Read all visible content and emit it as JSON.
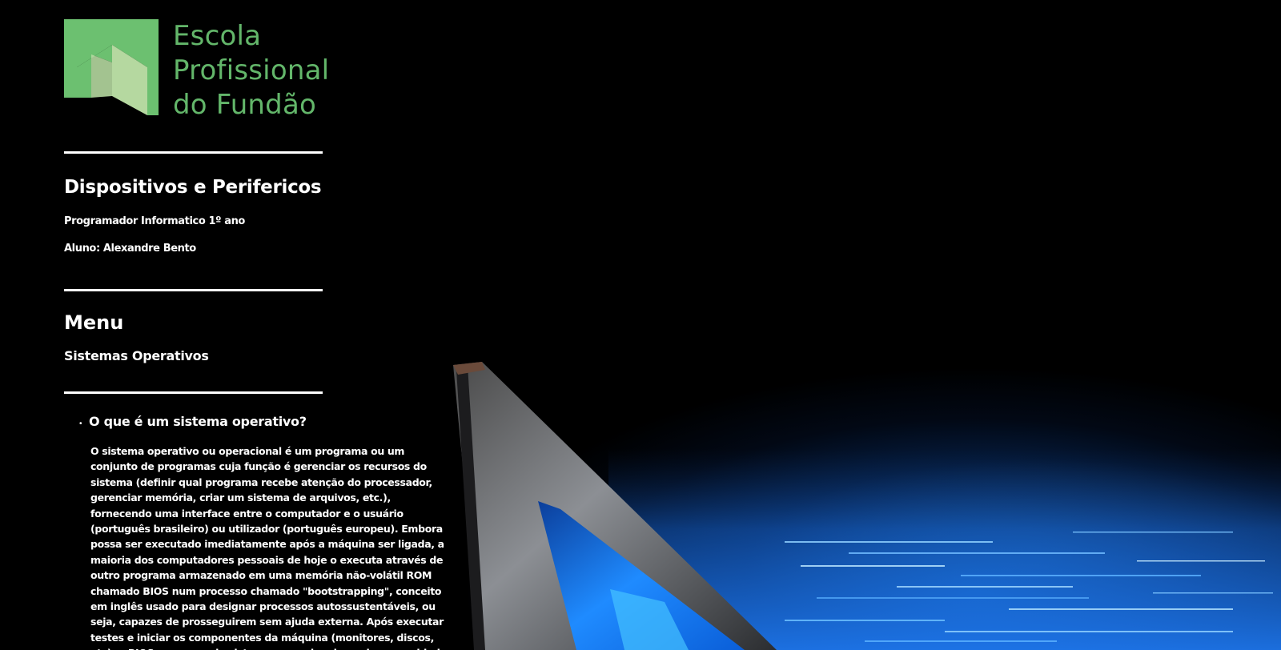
{
  "logo": {
    "line1": "Escola",
    "line2": "Profissional",
    "line3": "do Fundão",
    "color": "#63b66a",
    "mark_dark": "#6cc070",
    "mark_light": "#b5d8a0"
  },
  "header": {
    "title": "Dispositivos e Perifericos",
    "course": "Programador Informatico 1º ano",
    "student": "Aluno: Alexandre Bento"
  },
  "menu": {
    "heading": "Menu",
    "items": [
      {
        "label": "Sistemas Operativos"
      }
    ]
  },
  "content": {
    "question": "O que é um sistema operativo?",
    "paragraph": "O sistema operativo ou operacional é um programa ou um conjunto de programas cuja função é gerenciar os recursos do sistema (definir qual programa recebe atenção do processador, gerenciar memória, criar um sistema de arquivos, etc.), fornecendo uma interface entre o computador e o usuário (português brasileiro) ou utilizador (português europeu). Embora possa ser executado imediatamente após a máquina ser ligada, a maioria dos computadores pessoais de hoje o executa através de outro programa armazenado em uma memória não-volátil ROM chamado BIOS num processo chamado \"bootstrapping\", conceito em inglês usado para designar processos autossustentáveis, ou seja, capazes de prosseguirem sem ajuda externa. Após executar testes e iniciar os componentes da máquina (monitores, discos, etc), o BIOS procura pelo sistema operacional em alguma unidade de"
  },
  "background": {
    "image": "laptop-on-blue-light-trails",
    "accent": "#1e6fd0"
  }
}
